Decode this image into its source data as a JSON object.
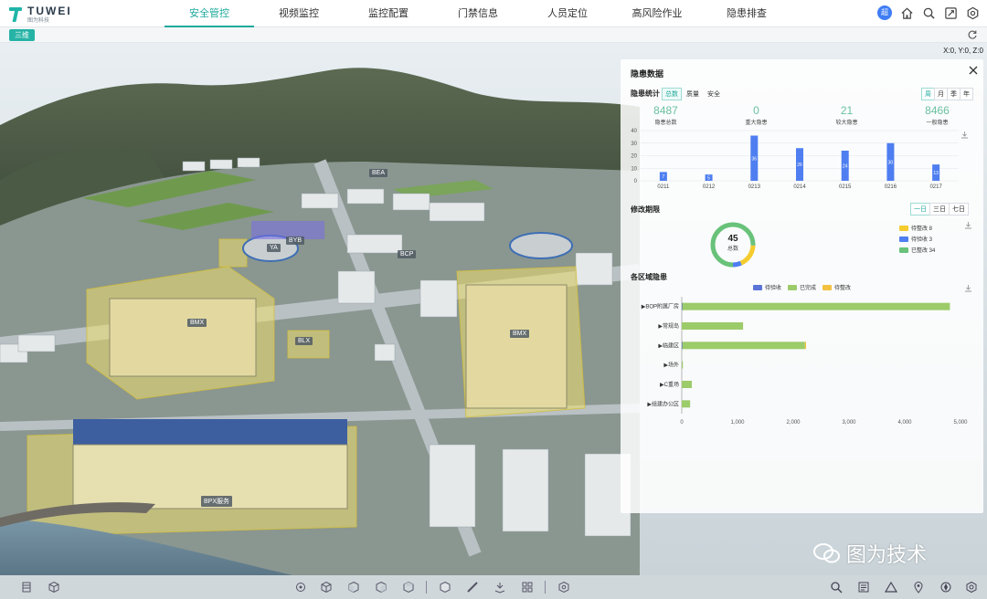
{
  "app": {
    "logo_name": "TUWEI",
    "logo_sub": "图为科技"
  },
  "nav": [
    {
      "label": "安全管控",
      "active": true
    },
    {
      "label": "视频监控"
    },
    {
      "label": "监控配置"
    },
    {
      "label": "门禁信息"
    },
    {
      "label": "人员定位"
    },
    {
      "label": "高风险作业"
    },
    {
      "label": "隐患排查"
    }
  ],
  "top_icons": [
    "avatar-icon",
    "home-icon",
    "search-icon",
    "fullscreen-icon",
    "settings-icon"
  ],
  "avatar_text": "超",
  "subbar": {
    "view_button": "三维"
  },
  "coord_readout": "X:0, Y:0, Z:0",
  "scene_labels": [
    {
      "text": "BEA"
    },
    {
      "text": "BYB"
    },
    {
      "text": "YA"
    },
    {
      "text": "BMX"
    },
    {
      "text": "BLX"
    },
    {
      "text": "BMX"
    },
    {
      "text": "BPX服务"
    },
    {
      "text": "BCP"
    }
  ],
  "panel": {
    "title": "隐患数据",
    "stats_section": {
      "title": "隐患统计",
      "tabs": [
        "总数",
        "质量",
        "安全"
      ],
      "active_tab": "总数",
      "periods": [
        "周",
        "月",
        "季",
        "年"
      ],
      "active_period": "周",
      "stats": [
        {
          "value": "8487",
          "label": "隐患总数"
        },
        {
          "value": "0",
          "label": "重大隐患"
        },
        {
          "value": "21",
          "label": "较大隐患"
        },
        {
          "value": "8466",
          "label": "一般隐患"
        }
      ]
    },
    "rectify_section": {
      "title": "修改期限",
      "periods": [
        "一日",
        "三日",
        "七日"
      ],
      "active_period": "一日",
      "total_value": "45",
      "total_label": "总数",
      "legend": [
        {
          "label": "待整改 8",
          "color": "#f4cc2e",
          "value": 8
        },
        {
          "label": "待验收 3",
          "color": "#4e7ef0",
          "value": 3
        },
        {
          "label": "已整改 34",
          "color": "#69c27a",
          "value": 34
        }
      ]
    },
    "area_section": {
      "title": "各区域隐患",
      "legend": [
        {
          "label": "待验收",
          "color": "#5b74d8"
        },
        {
          "label": "已完成",
          "color": "#9ccb6a"
        },
        {
          "label": "待整改",
          "color": "#f4c240"
        }
      ]
    }
  },
  "chart_data": [
    {
      "type": "bar",
      "categories": [
        "0211",
        "0212",
        "0213",
        "0214",
        "0215",
        "0216",
        "0217"
      ],
      "values": [
        7,
        5,
        36,
        26,
        24,
        30,
        13
      ],
      "ylim": [
        0,
        40
      ],
      "yticks": [
        0,
        10,
        20,
        30,
        40
      ],
      "color": "#4e7ef0"
    },
    {
      "type": "bar",
      "orientation": "horizontal",
      "categories": [
        "BOP附属厂房",
        "常规岛",
        "临建区",
        "场外",
        "C重场",
        "组建办公区"
      ],
      "series": [
        {
          "name": "待验收",
          "values": [
            10,
            0,
            10,
            0,
            0,
            0
          ]
        },
        {
          "name": "已完成",
          "values": [
            4800,
            1100,
            2200,
            20,
            180,
            150
          ]
        },
        {
          "name": "待整改",
          "values": [
            0,
            0,
            20,
            0,
            0,
            0
          ]
        }
      ],
      "xlim": [
        0,
        5000
      ],
      "xticks": [
        "0",
        "1,000",
        "2,000",
        "3,000",
        "4,000",
        "5,000"
      ]
    }
  ],
  "bottom_tools": [
    "layers-icon",
    "cube-icon",
    "locate-icon",
    "box-view-icon",
    "box-front-icon",
    "box-side-icon",
    "box-top-icon",
    "solid-cube-icon",
    "measure-icon",
    "terrain-icon",
    "grid-icon",
    "hex-icon",
    "search-icon",
    "notes-icon",
    "triangle-icon",
    "marker-icon",
    "compass-icon",
    "settings-icon"
  ],
  "watermark": "图为技术"
}
